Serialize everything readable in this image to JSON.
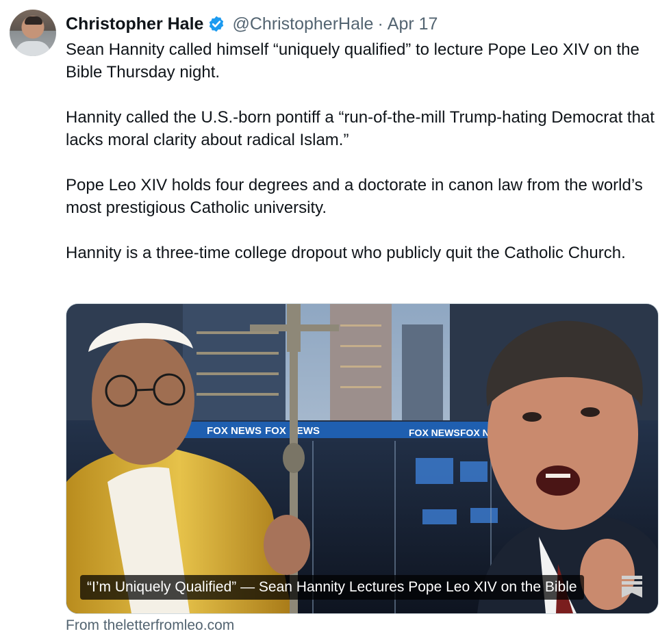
{
  "author": {
    "name": "Christopher Hale",
    "handle": "@ChristopherHale",
    "separator": "·",
    "date": "Apr 17",
    "verified": true
  },
  "tweet": {
    "paragraphs": [
      "Sean Hannity called himself “uniquely qualified” to lecture Pope Leo XIV on the Bible Thursday night.",
      "Hannity called the U.S.-born pontiff a “run-of-the-mill Trump-hating Democrat that lacks moral clarity about radical Islam.”",
      "Pope Leo XIV holds four degrees and a doctorate in canon law from the world’s most prestigious Catholic university.",
      "Hannity is a three-time college dropout who publicly quit the Catholic Church."
    ]
  },
  "card": {
    "caption": "“I’m Uniquely Qualified” — Sean Hannity Lectures Pope Leo XIV on the Bible",
    "image_signs": [
      "FOX NEWS",
      "FOX NEWS",
      "FOX NE",
      "FOX NEWS"
    ],
    "source": "From theletterfromleo.com"
  },
  "colors": {
    "text": "#0f1419",
    "muted": "#536471",
    "verified_blue": "#1d9bf0",
    "vestment_gold": "#d9b23a"
  }
}
